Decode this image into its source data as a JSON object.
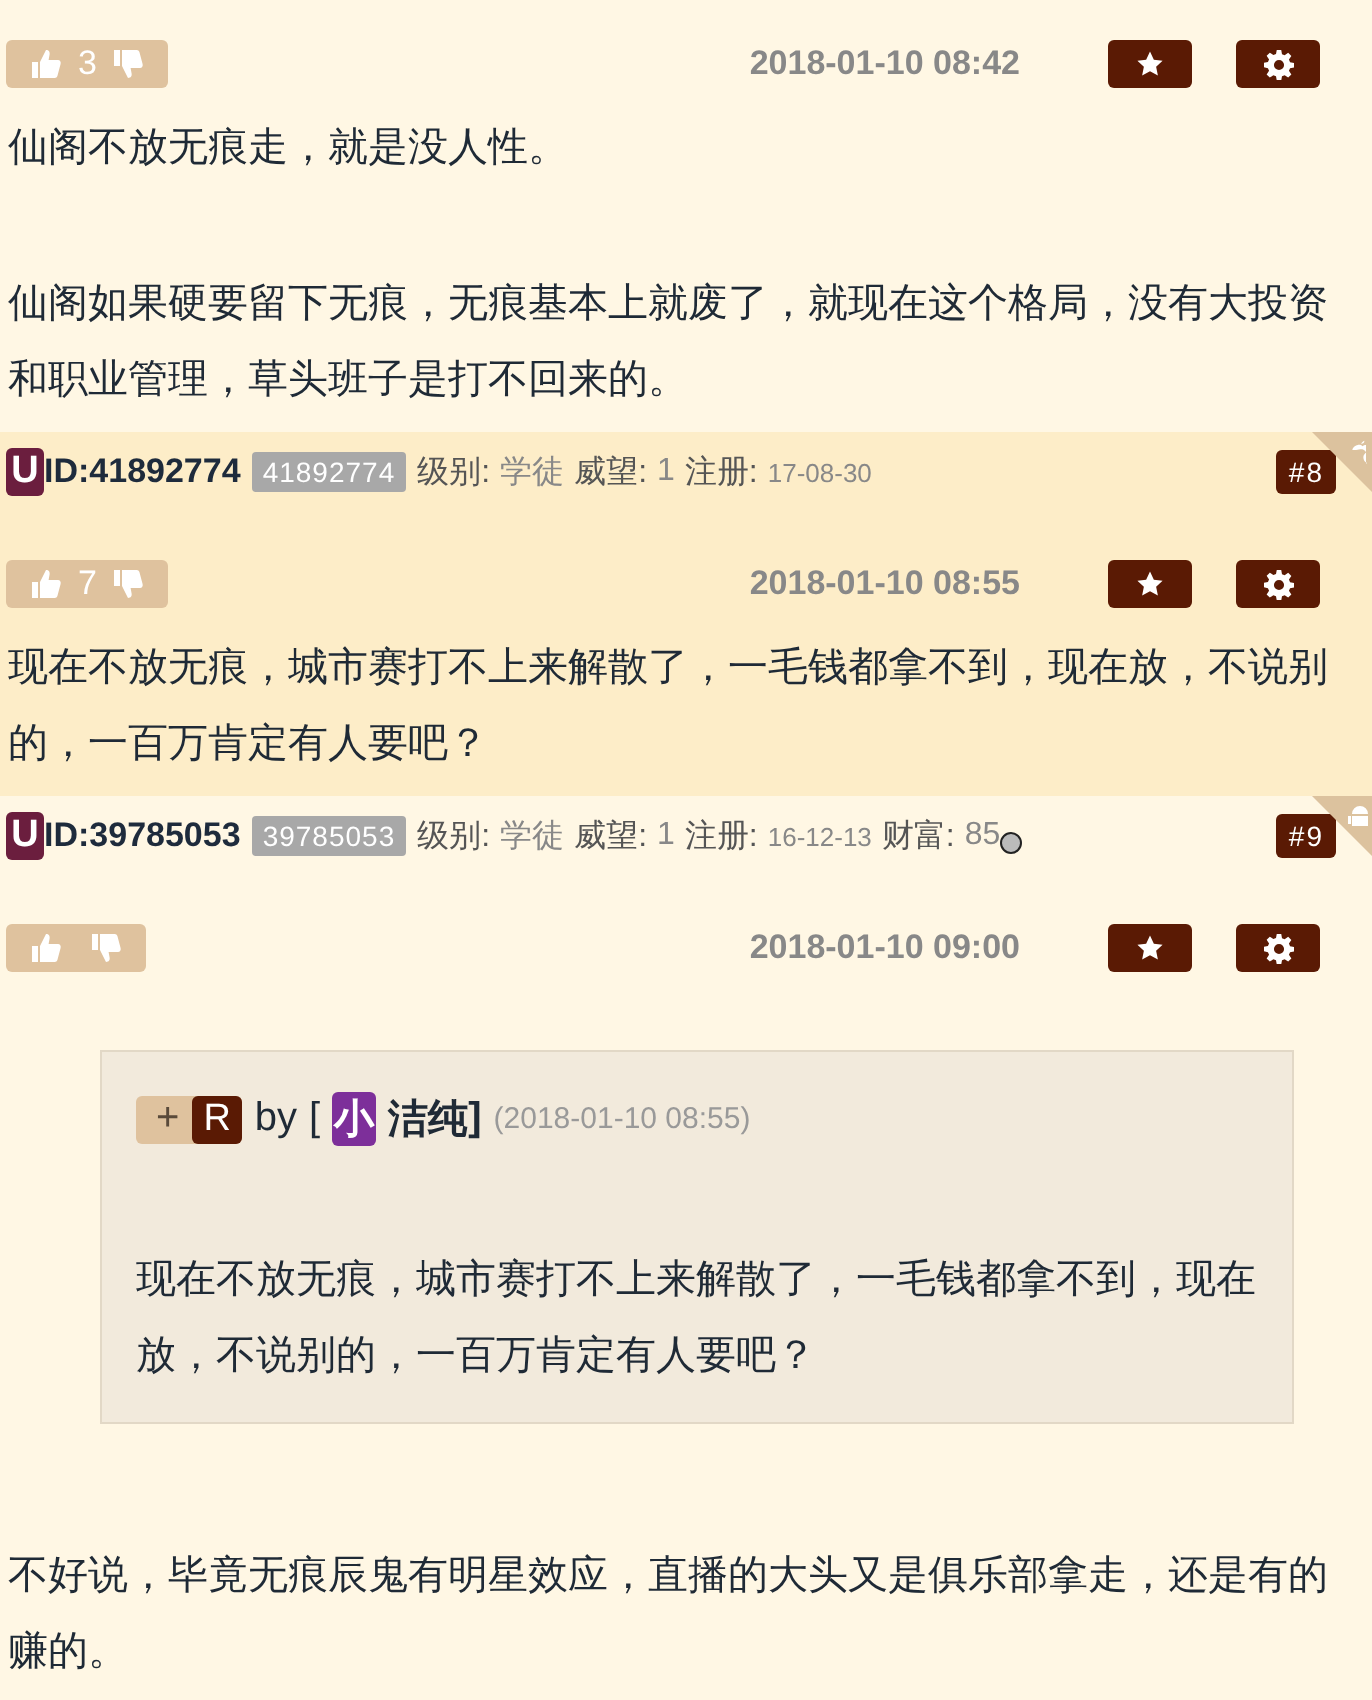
{
  "floors": [
    {
      "shaded": false,
      "post": {
        "votes": "3",
        "date": "2018-01-10 08:42",
        "paragraphs": [
          "仙阁不放无痕走，就是没人性。",
          "仙阁如果硬要留下无痕，无痕基本上就废了，就现在这个格局，没有大投资和职业管理，草头班子是打不回来的。"
        ]
      }
    },
    {
      "shaded": true,
      "user": {
        "avatar": "U",
        "uid": "ID:41892774",
        "badge": "41892774",
        "fields": [
          {
            "label": "级别:",
            "value": "学徒",
            "kind": "text"
          },
          {
            "label": "威望:",
            "value": "1",
            "kind": "text"
          },
          {
            "label": "注册:",
            "value": "17-08-30",
            "kind": "date"
          }
        ],
        "floor": "#8",
        "corner": {
          "kind": "apple"
        }
      },
      "post": {
        "votes": "7",
        "date": "2018-01-10 08:55",
        "paragraphs": [
          "现在不放无痕，城市赛打不上来解散了，一毛钱都拿不到，现在放，不说别的，一百万肯定有人要吧？"
        ]
      }
    },
    {
      "shaded": false,
      "user": {
        "avatar": "U",
        "uid": "ID:39785053",
        "badge": "39785053",
        "fields": [
          {
            "label": "级别:",
            "value": "学徒",
            "kind": "text"
          },
          {
            "label": "威望:",
            "value": "1",
            "kind": "text"
          },
          {
            "label": "注册:",
            "value": "16-12-13",
            "kind": "date"
          },
          {
            "label": "财富:",
            "value": "85",
            "kind": "coin"
          }
        ],
        "floor": "#9",
        "corner": {
          "kind": "android"
        }
      },
      "post": {
        "date": "2018-01-10 09:00",
        "quote": {
          "plus": "+",
          "badge": "R",
          "by": "by",
          "open": "[",
          "avatar": "小",
          "name": "洁纯",
          "close": "]",
          "time": "(2018-01-10 08:55)",
          "text": "现在不放无痕，城市赛打不上来解散了，一毛钱都拿不到，现在放，不说别的，一百万肯定有人要吧？"
        },
        "paragraphs": [
          "不好说，毕竟无痕辰鬼有明星效应，直播的大头又是俱乐部拿走，还是有的赚的。"
        ]
      }
    }
  ]
}
